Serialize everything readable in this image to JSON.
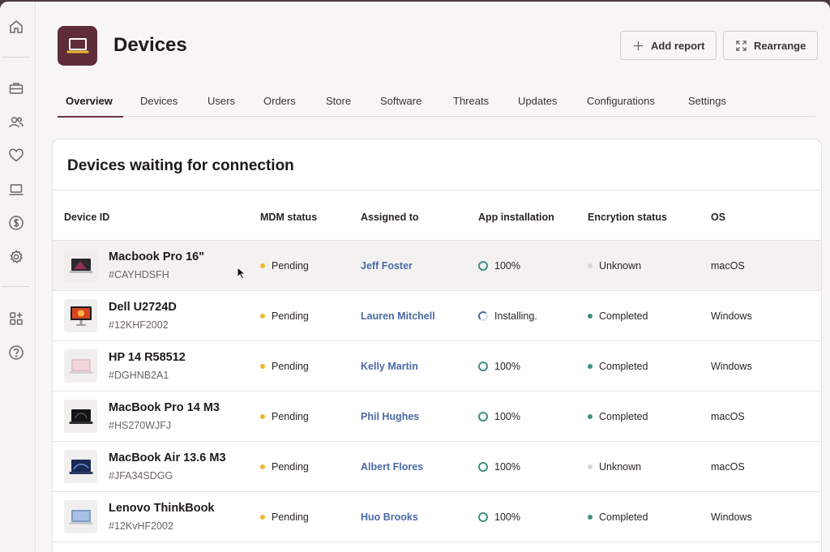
{
  "page": {
    "title": "Devices"
  },
  "sidebar": {
    "icons": [
      "home-icon",
      "briefcase-icon",
      "users-icon",
      "heart-icon",
      "laptop-icon",
      "dollar-icon",
      "gear-icon",
      "apps-add-icon",
      "help-icon"
    ]
  },
  "header": {
    "add_report_label": "Add report",
    "rearrange_label": "Rearrange"
  },
  "tabs": [
    {
      "label": "Overview",
      "active": true
    },
    {
      "label": "Devices"
    },
    {
      "label": "Users"
    },
    {
      "label": "Orders"
    },
    {
      "label": "Store"
    },
    {
      "label": "Software"
    },
    {
      "label": "Threats"
    },
    {
      "label": "Updates"
    },
    {
      "label": "Configurations"
    },
    {
      "label": "Settings"
    }
  ],
  "card": {
    "title": "Devices waiting for connection",
    "columns": [
      "Device ID",
      "MDM status",
      "Assigned to",
      "App installation",
      "Encrytion status",
      "OS"
    ],
    "rows": [
      {
        "name": "Macbook Pro 16\"",
        "id": "#CAYHDSFH",
        "mdm": "Pending",
        "assigned": "Jeff Foster",
        "app": "100%",
        "app_state": "done",
        "enc": "Unknown",
        "enc_state": "unknown",
        "os": "macOS",
        "thumb": "macbook-dark"
      },
      {
        "name": "Dell U2724D",
        "id": "#12KHF2002",
        "mdm": "Pending",
        "assigned": "Lauren Mitchell",
        "app": "Installing.",
        "app_state": "installing",
        "enc": "Completed",
        "enc_state": "completed",
        "os": "Windows",
        "thumb": "monitor"
      },
      {
        "name": "HP 14 R58512",
        "id": "#DGHNB2A1",
        "mdm": "Pending",
        "assigned": "Kelly Martin",
        "app": "100%",
        "app_state": "done",
        "enc": "Completed",
        "enc_state": "completed",
        "os": "Windows",
        "thumb": "laptop-pink"
      },
      {
        "name": "MacBook Pro 14 M3",
        "id": "#HS270WJFJ",
        "mdm": "Pending",
        "assigned": "Phil Hughes",
        "app": "100%",
        "app_state": "done",
        "enc": "Completed",
        "enc_state": "completed",
        "os": "macOS",
        "thumb": "macbook-black"
      },
      {
        "name": "MacBook Air 13.6 M3",
        "id": "#JFA34SDGG",
        "mdm": "Pending",
        "assigned": "Albert Flores",
        "app": "100%",
        "app_state": "done",
        "enc": "Unknown",
        "enc_state": "unknown",
        "os": "macOS",
        "thumb": "macbook-blue"
      },
      {
        "name": "Lenovo ThinkBook",
        "id": "#12KvHF2002",
        "mdm": "Pending",
        "assigned": "Huo Brooks",
        "app": "100%",
        "app_state": "done",
        "enc": "Completed",
        "enc_state": "completed",
        "os": "Windows",
        "thumb": "laptop-silver"
      }
    ]
  },
  "colors": {
    "accent": "#5e2d37",
    "pending": "#f2b632",
    "completed": "#3f8f83",
    "unknown": "#d9d6d6",
    "link": "#4a6aa5"
  }
}
